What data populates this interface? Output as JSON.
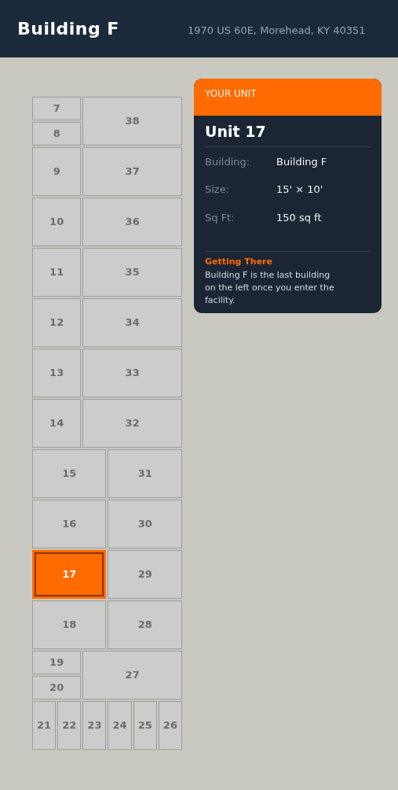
{
  "header": {
    "title": "Building F",
    "address": "1970 US 60E, Morehead, KY 40351"
  },
  "floor_plan": {
    "rows": [
      {
        "kind": "split-narrow",
        "units": [
          {
            "label": "7",
            "selected": false
          },
          {
            "label": "8",
            "selected": false
          },
          {
            "label": "38",
            "selected": false
          }
        ]
      },
      {
        "kind": "pair-narrow",
        "units": [
          {
            "label": "9",
            "selected": false
          },
          {
            "label": "37",
            "selected": false
          }
        ]
      },
      {
        "kind": "pair-narrow",
        "units": [
          {
            "label": "10",
            "selected": false
          },
          {
            "label": "36",
            "selected": false
          }
        ]
      },
      {
        "kind": "pair-narrow",
        "units": [
          {
            "label": "11",
            "selected": false
          },
          {
            "label": "35",
            "selected": false
          }
        ]
      },
      {
        "kind": "pair-narrow",
        "units": [
          {
            "label": "12",
            "selected": false
          },
          {
            "label": "34",
            "selected": false
          }
        ]
      },
      {
        "kind": "pair-narrow",
        "units": [
          {
            "label": "13",
            "selected": false
          },
          {
            "label": "33",
            "selected": false
          }
        ]
      },
      {
        "kind": "pair-narrow",
        "units": [
          {
            "label": "14",
            "selected": false
          },
          {
            "label": "32",
            "selected": false
          }
        ]
      },
      {
        "kind": "pair-wide",
        "units": [
          {
            "label": "15",
            "selected": false
          },
          {
            "label": "31",
            "selected": false
          }
        ]
      },
      {
        "kind": "pair-wide",
        "units": [
          {
            "label": "16",
            "selected": false
          },
          {
            "label": "30",
            "selected": false
          }
        ]
      },
      {
        "kind": "pair-wide",
        "units": [
          {
            "label": "17",
            "selected": true
          },
          {
            "label": "29",
            "selected": false
          }
        ]
      },
      {
        "kind": "pair-wide",
        "units": [
          {
            "label": "18",
            "selected": false
          },
          {
            "label": "28",
            "selected": false
          }
        ]
      },
      {
        "kind": "split-narrow",
        "units": [
          {
            "label": "19",
            "selected": false
          },
          {
            "label": "20",
            "selected": false
          },
          {
            "label": "27",
            "selected": false
          }
        ]
      },
      {
        "kind": "singles",
        "units": [
          {
            "label": "21",
            "selected": false
          },
          {
            "label": "22",
            "selected": false
          },
          {
            "label": "23",
            "selected": false
          },
          {
            "label": "24",
            "selected": false
          },
          {
            "label": "25",
            "selected": false
          },
          {
            "label": "26",
            "selected": false
          }
        ]
      }
    ]
  },
  "unit_card": {
    "eyebrow": "YOUR UNIT",
    "title": "Unit 17",
    "details": [
      {
        "label": "Building:",
        "value": "Building F"
      },
      {
        "label": "Size:",
        "value": "15' × 10'"
      },
      {
        "label": "Sq Ft:",
        "value": "150 sq ft"
      }
    ],
    "directions": {
      "heading": "Getting There",
      "text": "Building F is the last building on the left once you enter the facility."
    }
  }
}
